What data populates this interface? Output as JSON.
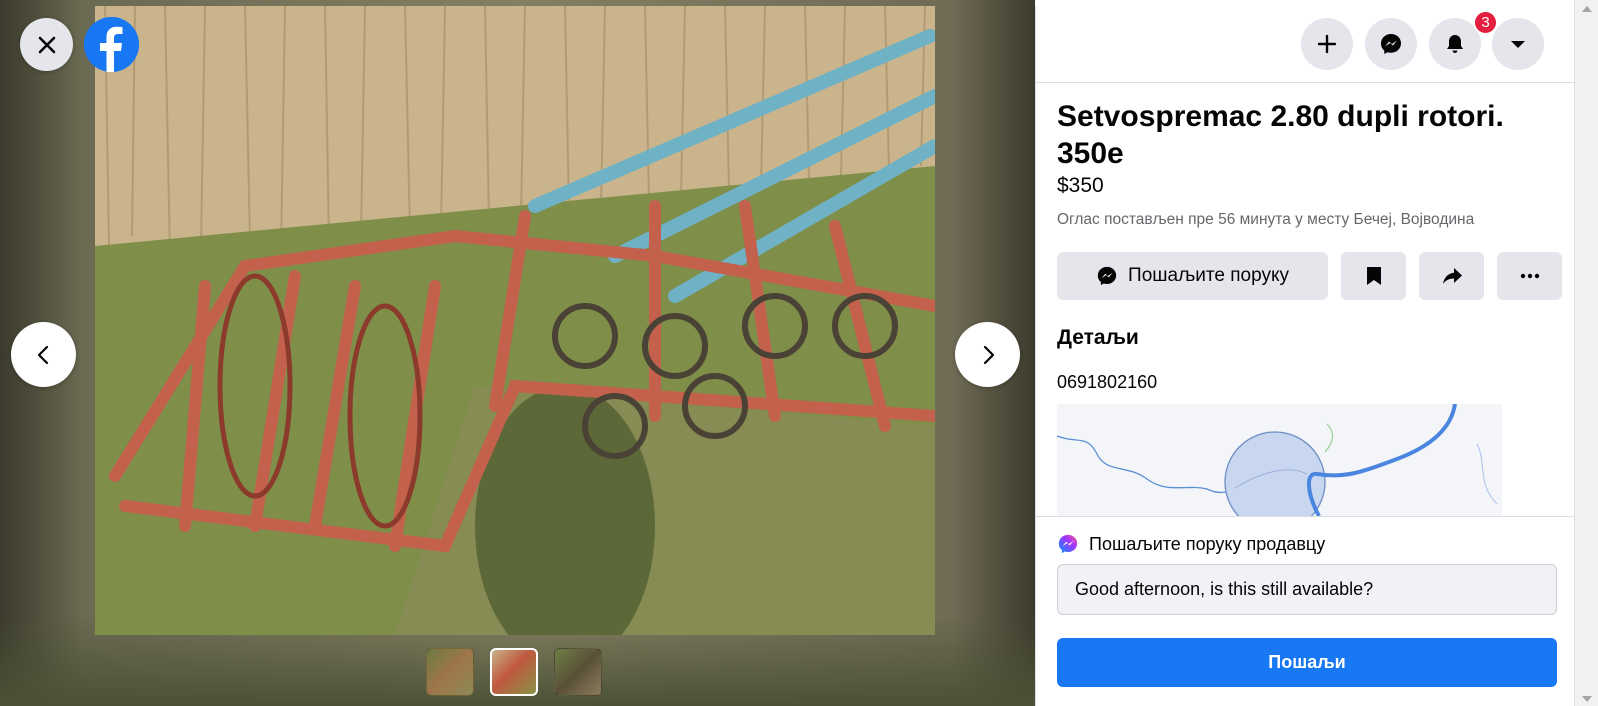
{
  "viewer": {
    "logo_letter": "f",
    "thumbnails": [
      "photo-1",
      "photo-2",
      "photo-3"
    ]
  },
  "topbar": {
    "icons": [
      "plus-icon",
      "messenger-icon",
      "bell-icon",
      "caret-down-icon"
    ],
    "notification_count": "3"
  },
  "listing": {
    "title": "Setvospremac 2.80 dupli rotori. 350e",
    "price": "$350",
    "meta": "Оглас постављен пре 56 минута у месту Бечеј, Војводина"
  },
  "actions": {
    "send_message_label": "Пошаљите поруку"
  },
  "details": {
    "heading": "Детаљи",
    "description": "0691802160"
  },
  "composer": {
    "label": "Пошаљите поруку продавцу",
    "input_value": "Good afternoon, is this still available?",
    "submit_label": "Пошаљи"
  },
  "colors": {
    "brand": "#1877f2",
    "badge": "#e41e3f",
    "button_bg": "#e4e6eb"
  }
}
